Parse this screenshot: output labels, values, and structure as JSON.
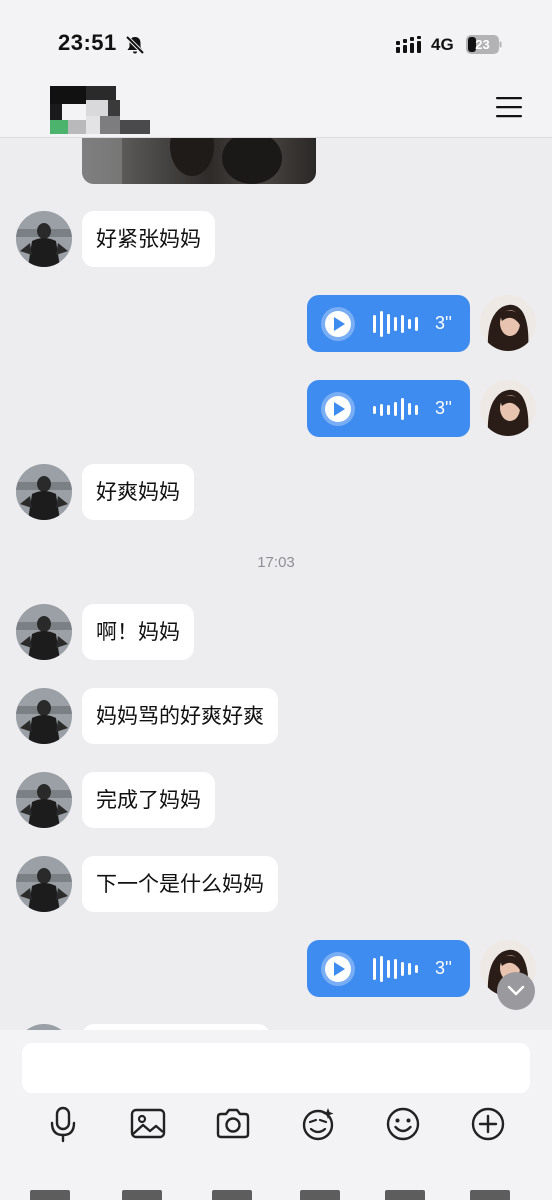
{
  "status_bar": {
    "time": "23:51",
    "network": "4G",
    "battery": "23"
  },
  "header": {
    "contact_name": "",
    "menu_icon": "menu-icon"
  },
  "messages": {
    "m1": "好紧张妈妈",
    "m2": "好爽妈妈",
    "m3": "啊！妈妈",
    "m4": "妈妈骂的好爽好爽",
    "m5": "完成了妈妈",
    "m6": "下一个是什么妈妈"
  },
  "voice": {
    "v1": "3''",
    "v2": "3''",
    "v3": "3''"
  },
  "timestamp": "17:03",
  "input": {
    "placeholder": ""
  },
  "toolbar": {
    "icons": [
      "microphone-icon",
      "image-icon",
      "camera-icon",
      "sticker-icon",
      "emoji-icon",
      "plus-icon"
    ]
  },
  "colors": {
    "voice_bubble": "#3f8cf0",
    "incoming_bubble": "#ffffff",
    "background": "#ededf0"
  }
}
